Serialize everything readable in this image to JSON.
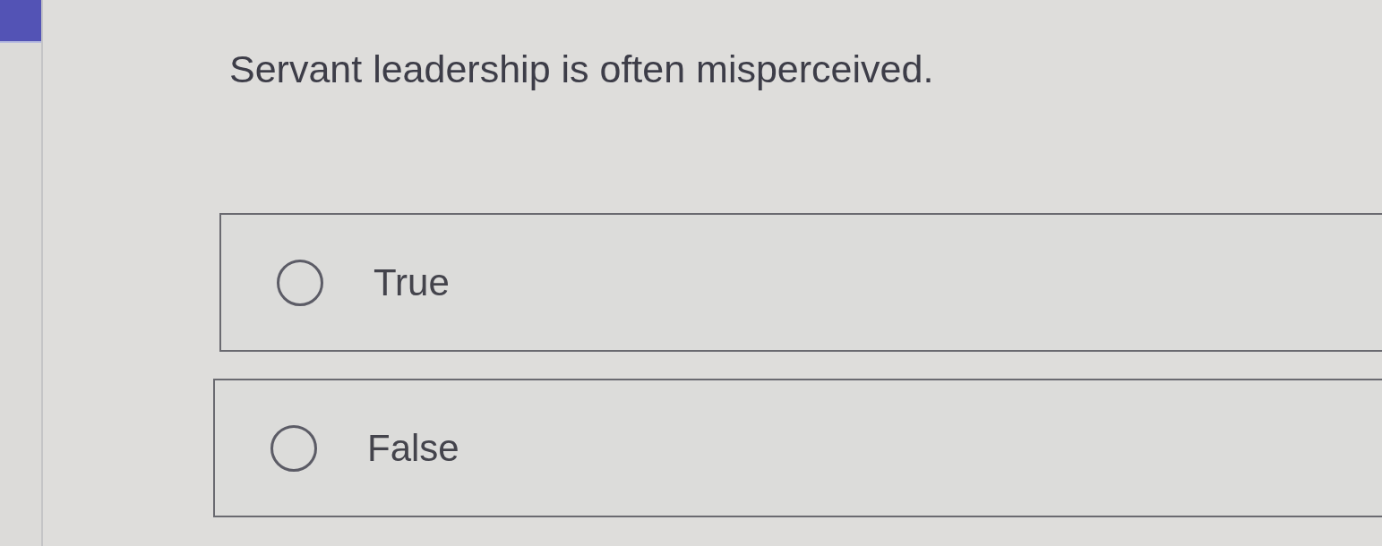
{
  "question": "Servant leadership is often misperceived.",
  "options": [
    {
      "label": "True",
      "selected": false
    },
    {
      "label": "False",
      "selected": false
    }
  ]
}
